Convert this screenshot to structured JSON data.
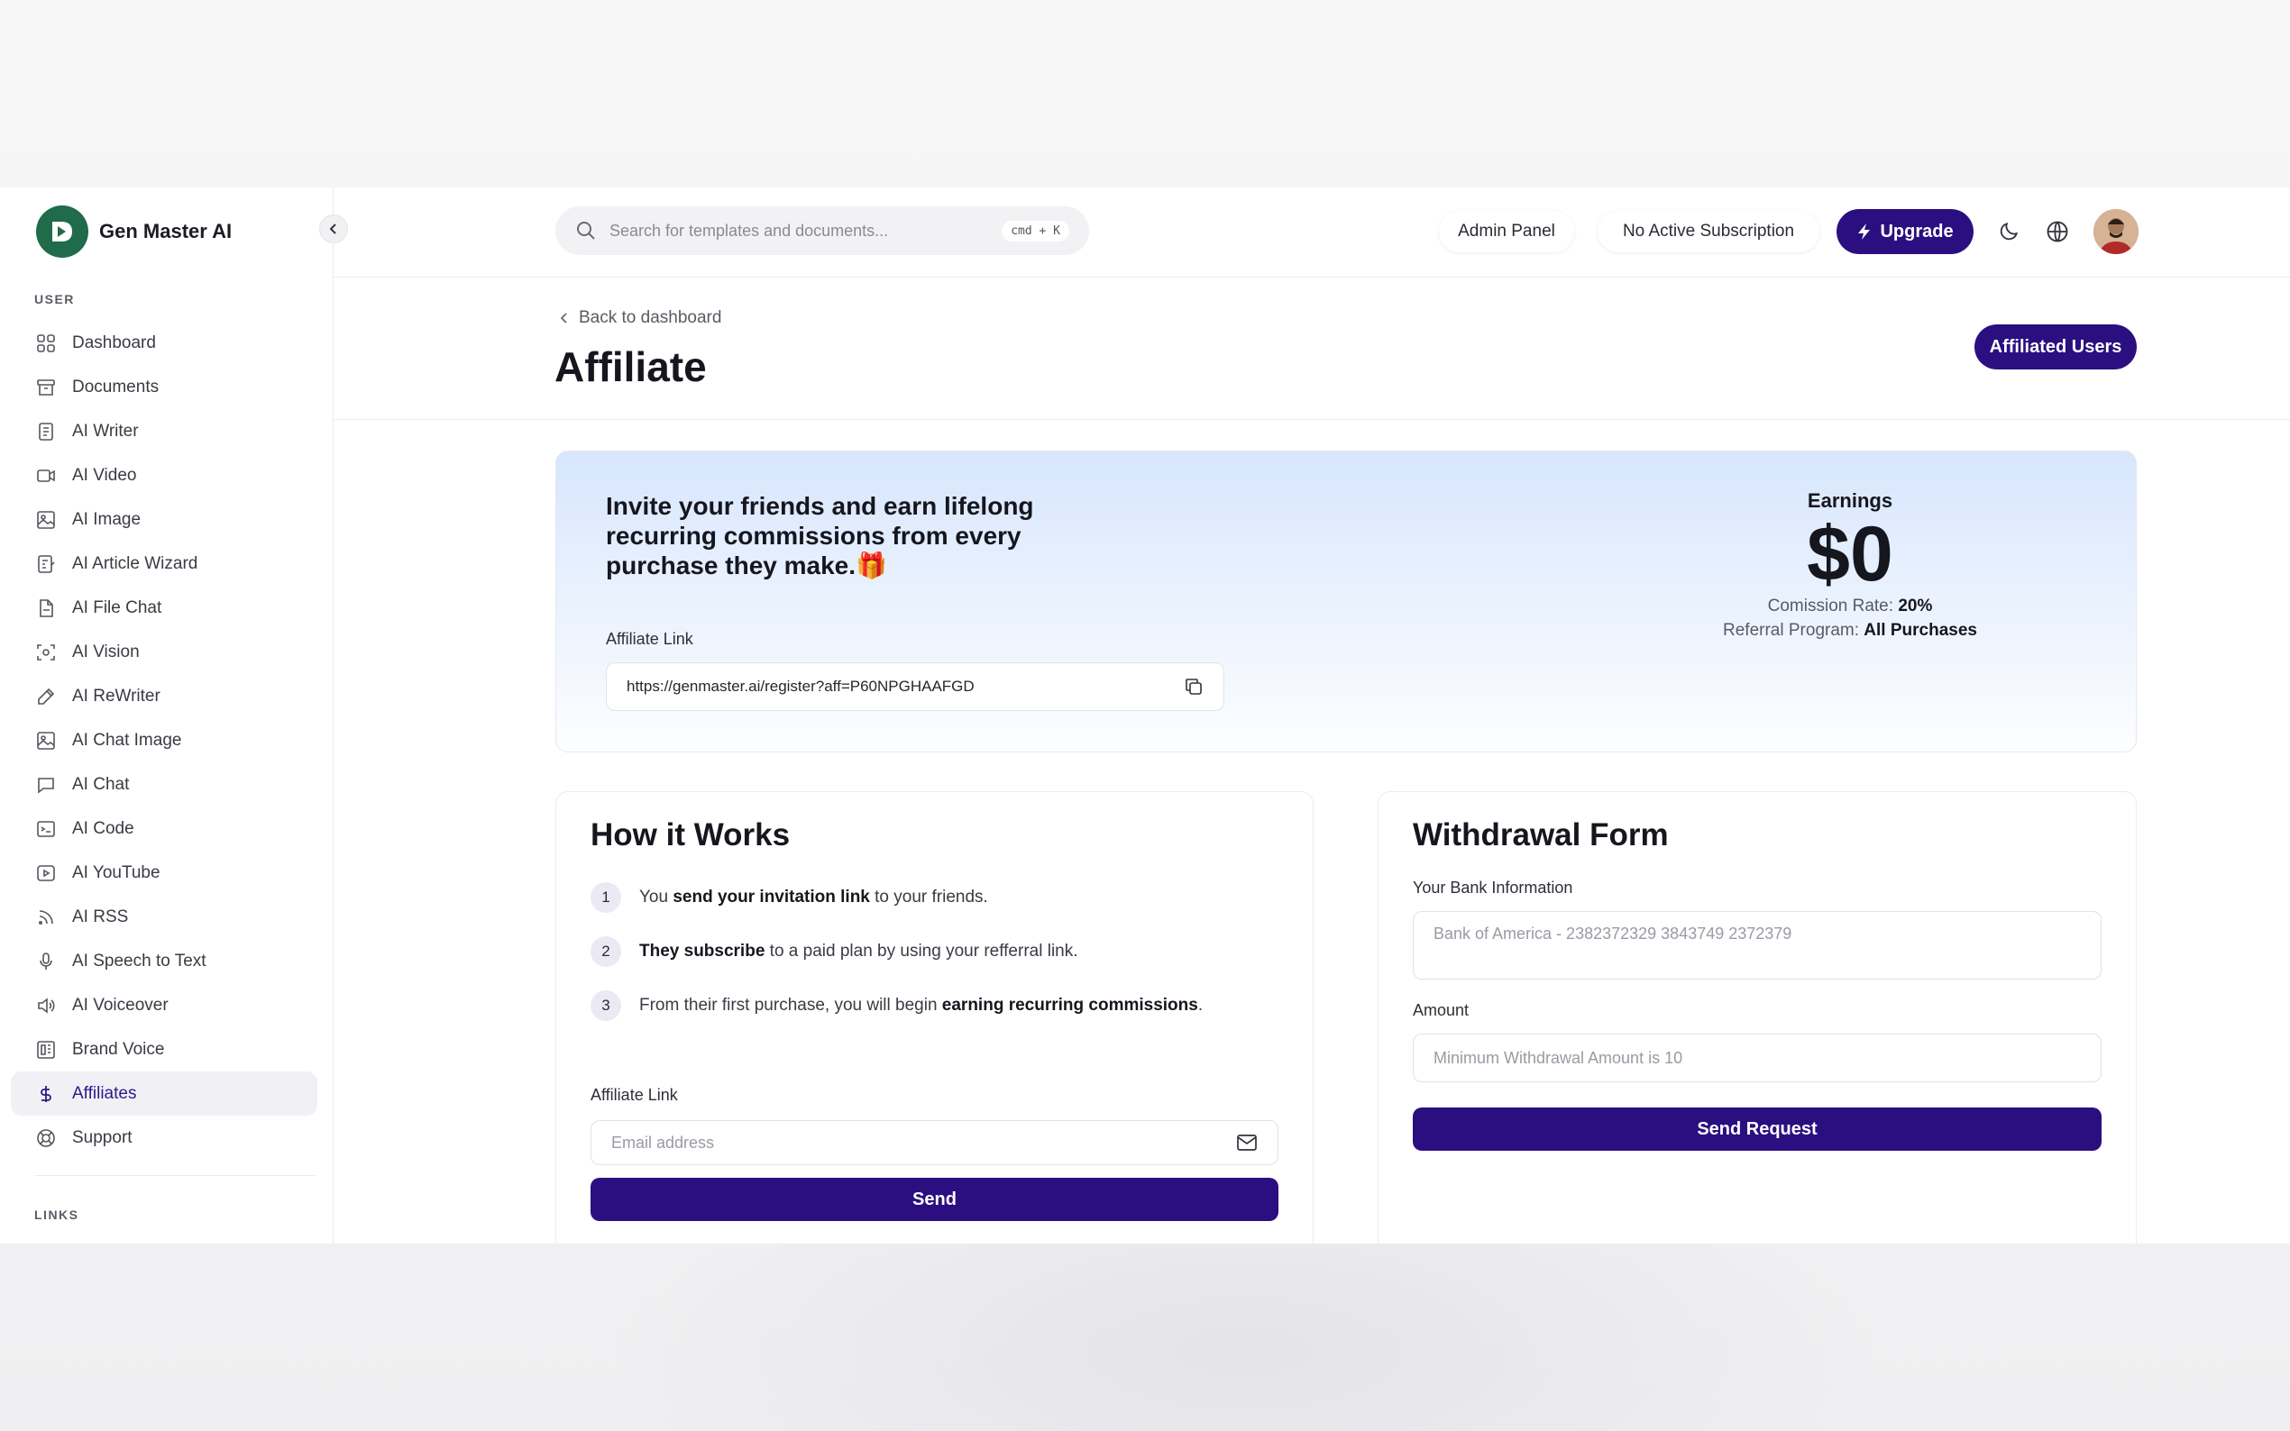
{
  "brand": {
    "name": "Gen Master AI"
  },
  "sidebar": {
    "section_user": "USER",
    "section_links": "LINKS",
    "items": [
      {
        "label": "Dashboard",
        "icon": "grid-icon"
      },
      {
        "label": "Documents",
        "icon": "archive-icon"
      },
      {
        "label": "AI Writer",
        "icon": "document-icon"
      },
      {
        "label": "AI Video",
        "icon": "video-icon"
      },
      {
        "label": "AI Image",
        "icon": "image-icon"
      },
      {
        "label": "AI Article Wizard",
        "icon": "article-icon"
      },
      {
        "label": "AI File Chat",
        "icon": "file-chat-icon"
      },
      {
        "label": "AI Vision",
        "icon": "scan-icon"
      },
      {
        "label": "AI ReWriter",
        "icon": "pen-icon"
      },
      {
        "label": "AI Chat Image",
        "icon": "image-icon"
      },
      {
        "label": "AI Chat",
        "icon": "chat-icon"
      },
      {
        "label": "AI Code",
        "icon": "terminal-icon"
      },
      {
        "label": "AI YouTube",
        "icon": "youtube-icon"
      },
      {
        "label": "AI RSS",
        "icon": "rss-icon"
      },
      {
        "label": "AI Speech to Text",
        "icon": "microphone-icon"
      },
      {
        "label": "AI Voiceover",
        "icon": "speaker-icon"
      },
      {
        "label": "Brand Voice",
        "icon": "brand-icon"
      },
      {
        "label": "Affiliates",
        "icon": "dollar-icon",
        "active": true
      },
      {
        "label": "Support",
        "icon": "lifebuoy-icon"
      }
    ]
  },
  "topbar": {
    "search_placeholder": "Search for templates and documents...",
    "shortcut": "cmd + K",
    "admin_panel": "Admin Panel",
    "subscription": "No Active Subscription",
    "upgrade": "Upgrade"
  },
  "header": {
    "back": "Back to dashboard",
    "title": "Affiliate",
    "affiliated_users": "Affiliated Users"
  },
  "hero": {
    "headline": "Invite your friends and earn lifelong recurring commissions from every purchase they make.🎁",
    "link_label": "Affiliate Link",
    "link_value": "https://genmaster.ai/register?aff=P60NPGHAAFGD",
    "earnings_title": "Earnings",
    "earnings_amount": "$0",
    "commission_label": "Comission Rate:",
    "commission_value": "20%",
    "referral_label": "Referral Program:",
    "referral_value": "All Purchases"
  },
  "how_it_works": {
    "title": "How it Works",
    "steps": [
      {
        "num": "1",
        "pre": "You ",
        "bold": "send your invitation link",
        "post": " to your friends."
      },
      {
        "num": "2",
        "pre": "",
        "bold": "They subscribe",
        "post": " to a paid plan by using your refferral link."
      },
      {
        "num": "3",
        "pre": "From their first purchase, you will begin ",
        "bold": "earning recurring commissions",
        "post": "."
      }
    ],
    "link_label": "Affiliate Link",
    "email_placeholder": "Email address",
    "send": "Send"
  },
  "withdrawal": {
    "title": "Withdrawal Form",
    "bank_label": "Your Bank Information",
    "bank_placeholder": "Bank of America - 2382372329 3843749 2372379",
    "amount_label": "Amount",
    "amount_placeholder": "Minimum Withdrawal Amount is 10",
    "submit": "Send Request"
  },
  "colors": {
    "accent": "#2b0f80",
    "logo": "#1f6b4a",
    "hero_top": "#d7e6fd"
  }
}
